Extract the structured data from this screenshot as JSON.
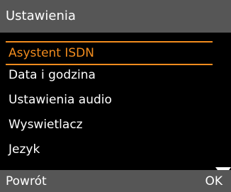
{
  "header": {
    "title": "Ustawienia"
  },
  "menu": {
    "items": [
      {
        "label": "Asystent ISDN",
        "selected": true
      },
      {
        "label": "Data i godzina",
        "selected": false
      },
      {
        "label": "Ustawienia audio",
        "selected": false
      },
      {
        "label": "Wyswietlacz",
        "selected": false
      },
      {
        "label": "Jezyk",
        "selected": false
      }
    ],
    "more_indicator": "scroll-down-arrow-icon"
  },
  "softkeys": {
    "left_label": "Powrót",
    "right_label": "OK"
  },
  "colors": {
    "bar_background": "#565656",
    "screen_background": "#000000",
    "highlight": "#f28c1e",
    "text": "#ffffff"
  }
}
